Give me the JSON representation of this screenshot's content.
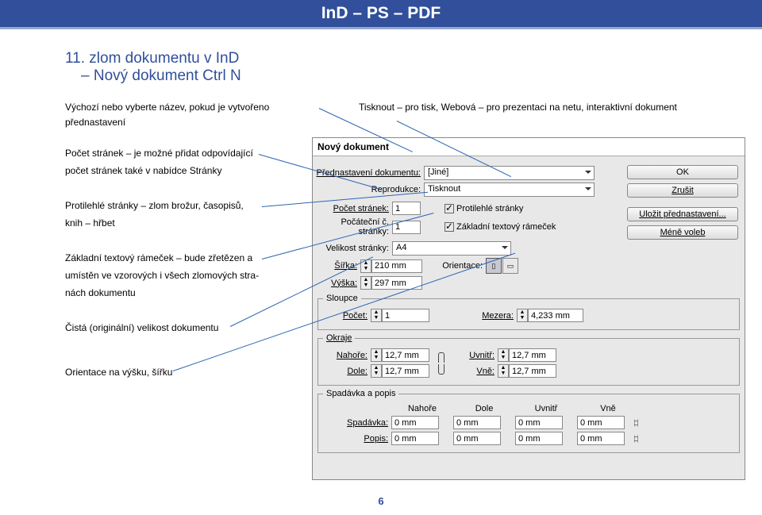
{
  "topbar": "InD – PS – PDF",
  "heading": {
    "line1": "11. zlom dokumentu v InD",
    "line2": "– Nový dokument Ctrl N"
  },
  "left_text": {
    "p1": "Výchozí nebo vyberte název, pokud je vytvořeno přednastavení",
    "p2a": "Počet stránek – je možné přidat odpovídající",
    "p2b": "počet stránek také v nabídce Stránky",
    "p3a": "Protilehlé stránky – zlom brožur, časopisů,",
    "p3b": "knih – hřbet",
    "p4a": "Základní textový rámeček – bude zřetězen a",
    "p4b": "umístěn ve vzorových i všech zlomových stra-",
    "p4c": "nách dokumentu",
    "p5": "Čistá (originální) velikost dokumentu",
    "p6": "Orientace na výšku, šířku"
  },
  "right_text": "Tisknout – pro tisk, Webová – pro prezentaci na netu, interaktivní dokument",
  "dlg": {
    "title": "Nový dokument",
    "preset_label": "Přednastavení dokumentu:",
    "preset_value": "[Jiné]",
    "reproduce_label": "Reprodukce:",
    "reproduce_value": "Tisknout",
    "pages_label": "Počet stránek:",
    "pages_value": "1",
    "startpage_label": "Počáteční č. stránky:",
    "startpage_value": "1",
    "facing": "Protilehlé stránky",
    "textframe": "Základní textový rámeček",
    "size_label": "Velikost stránky:",
    "size_value": "A4",
    "width_label": "Šířka:",
    "width_value": "210 mm",
    "height_label": "Výška:",
    "height_value": "297 mm",
    "orient_label": "Orientace:",
    "columns_legend": "Sloupce",
    "col_count_label": "Počet:",
    "col_count_value": "1",
    "gutter_label": "Mezera:",
    "gutter_value": "4,233 mm",
    "margins_legend": "Okraje",
    "m_top_label": "Nahoře:",
    "m_top_value": "12,7 mm",
    "m_bottom_label": "Dole:",
    "m_bottom_value": "12,7 mm",
    "m_inside_label": "Uvnitř:",
    "m_inside_value": "12,7 mm",
    "m_outside_label": "Vně:",
    "m_outside_value": "12,7 mm",
    "bleed_legend": "Spadávka a popis",
    "b_top": "Nahoře",
    "b_bot": "Dole",
    "b_in": "Uvnitř",
    "b_out": "Vně",
    "bleed_label": "Spadávka:",
    "slug_label": "Popis:",
    "zero": "0 mm",
    "ok": "OK",
    "cancel": "Zrušit",
    "savepreset": "Uložit přednastavení...",
    "less": "Méně voleb"
  },
  "pagenum": "6"
}
